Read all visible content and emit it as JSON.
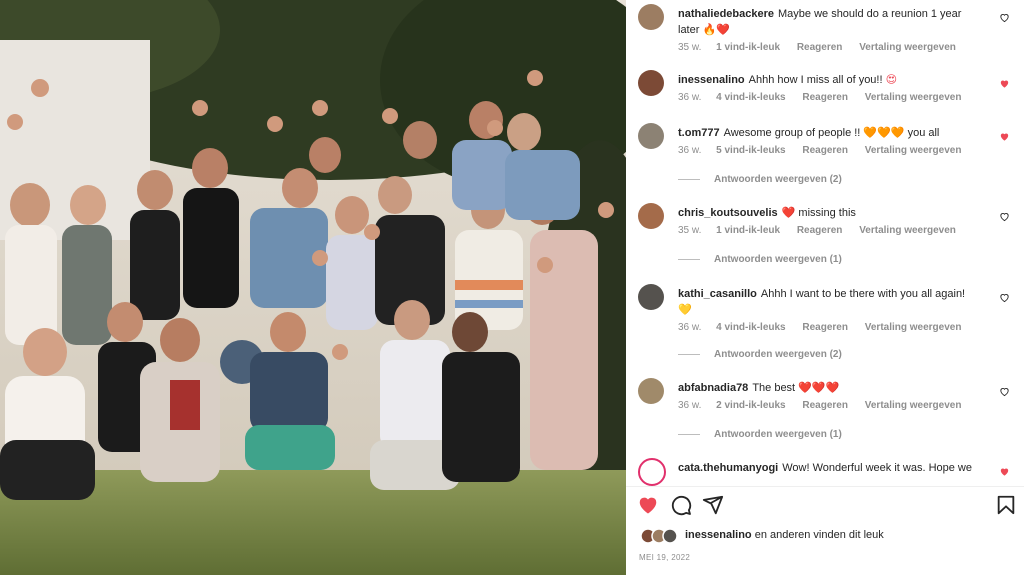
{
  "post": {
    "comments": [
      {
        "username": "nathaliedebackere",
        "text": "Maybe we should do a reunion 1 year later",
        "emoji": "🔥❤️",
        "time": "35 w.",
        "likes": "1 vind-ik-leuk",
        "reply": "Reageren",
        "translate": "Vertaling weergeven",
        "liked": false,
        "replies": ""
      },
      {
        "username": "inessenalino",
        "text": "Ahhh how I miss all of you!!",
        "emoji": "😍",
        "time": "36 w.",
        "likes": "4 vind-ik-leuks",
        "reply": "Reageren",
        "translate": "Vertaling weergeven",
        "liked": true,
        "replies": ""
      },
      {
        "username": "t.om777",
        "text": "Awesome group of people !!",
        "emoji": "🧡🧡🧡",
        "text2": "you all",
        "time": "36 w.",
        "likes": "5 vind-ik-leuks",
        "reply": "Reageren",
        "translate": "Vertaling weergeven",
        "liked": true,
        "replies": "Antwoorden weergeven (2)"
      },
      {
        "username": "chris_koutsouvelis",
        "emoji_before": "❤️",
        "text": "missing this",
        "time": "35 w.",
        "likes": "1 vind-ik-leuk",
        "reply": "Reageren",
        "translate": "Vertaling weergeven",
        "liked": false,
        "replies": "Antwoorden weergeven (1)"
      },
      {
        "username": "kathi_casanillo",
        "text": "Ahhh I want to be there with you all again!",
        "emoji": "💛",
        "time": "36 w.",
        "likes": "4 vind-ik-leuks",
        "reply": "Reageren",
        "translate": "Vertaling weergeven",
        "liked": false,
        "replies": "Antwoorden weergeven (2)"
      },
      {
        "username": "abfabnadia78",
        "text": "The best",
        "emoji": "❤️❤️❤️",
        "time": "36 w.",
        "likes": "2 vind-ik-leuks",
        "reply": "Reageren",
        "translate": "Vertaling weergeven",
        "liked": false,
        "replies": "Antwoorden weergeven (1)"
      },
      {
        "username": "cata.thehumanyogi",
        "text": "Wow! Wonderful week it was. Hope we",
        "time": "",
        "likes": "",
        "reply": "",
        "translate": "",
        "liked": true,
        "replies": ""
      }
    ],
    "liked_by": "inessenalino",
    "liked_by_suffix": "en anderen vinden dit leuk",
    "date": "MEI 19, 2022"
  },
  "colors": {
    "like_red": "#ed4956",
    "muted": "#8e8e8e",
    "text": "#262626"
  },
  "icons": [
    "heart-icon",
    "comment-icon",
    "share-icon",
    "bookmark-icon"
  ]
}
